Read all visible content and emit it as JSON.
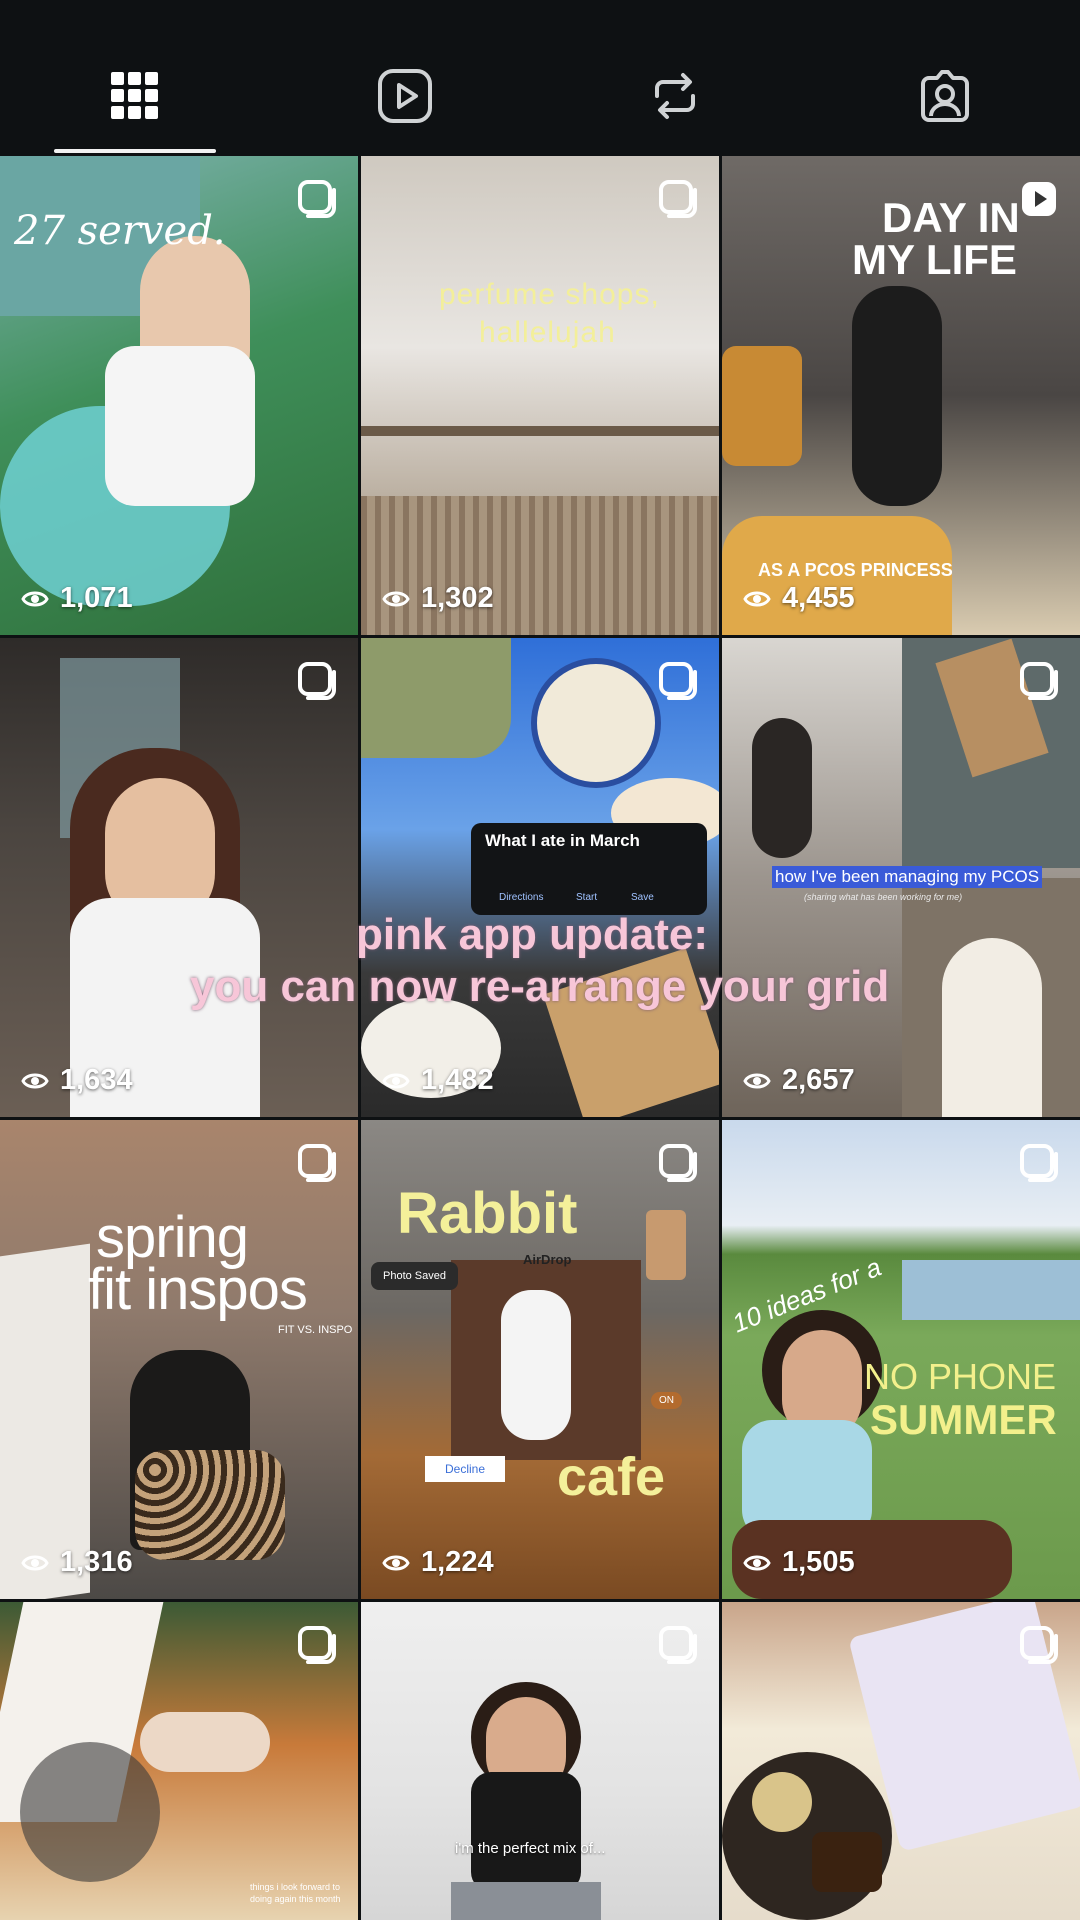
{
  "tabs": [
    {
      "name": "grid",
      "icon": "grid-icon",
      "active": true
    },
    {
      "name": "reels",
      "icon": "reels-icon",
      "active": false
    },
    {
      "name": "reposts",
      "icon": "repost-icon",
      "active": false
    },
    {
      "name": "tagged",
      "icon": "tagged-person-icon",
      "active": false
    }
  ],
  "grid": {
    "posts": [
      {
        "overlay": [
          "27 served."
        ],
        "views": "1,071"
      },
      {
        "overlay": [
          "perfume shops,",
          "hallelujah"
        ],
        "views": "1,302"
      },
      {
        "overlay": [
          "DAY IN",
          "MY LIFE",
          "AS A PCOS PRINCESS"
        ],
        "views": "4,455"
      },
      {
        "overlay": [],
        "views": "1,634"
      },
      {
        "overlay": [
          "What I ate in March",
          "Directions",
          "Start",
          "Save"
        ],
        "views": "1,482"
      },
      {
        "overlay": [
          "how I've been managing my PCOS",
          "(sharing what has been working for me)"
        ],
        "views": "2,657"
      },
      {
        "overlay": [
          "spring",
          "fit inspos",
          "FIT VS. INSPO"
        ],
        "views": "1,316"
      },
      {
        "overlay": [
          "Rabbit",
          "cafe",
          "Photo Saved",
          "AirDrop",
          "Decline",
          "ON"
        ],
        "views": "1,224"
      },
      {
        "overlay": [
          "10 ideas for a",
          "NO PHONE",
          "SUMMER"
        ],
        "views": "1,505"
      },
      {
        "overlay": [
          "things i look forward to",
          "doing again this month"
        ],
        "views": ""
      },
      {
        "overlay": [
          "i'm the perfect mix of..."
        ],
        "views": ""
      },
      {
        "overlay": [],
        "views": ""
      }
    ],
    "banner": [
      "pink app update:",
      "you can now re-arrange your grid"
    ]
  }
}
